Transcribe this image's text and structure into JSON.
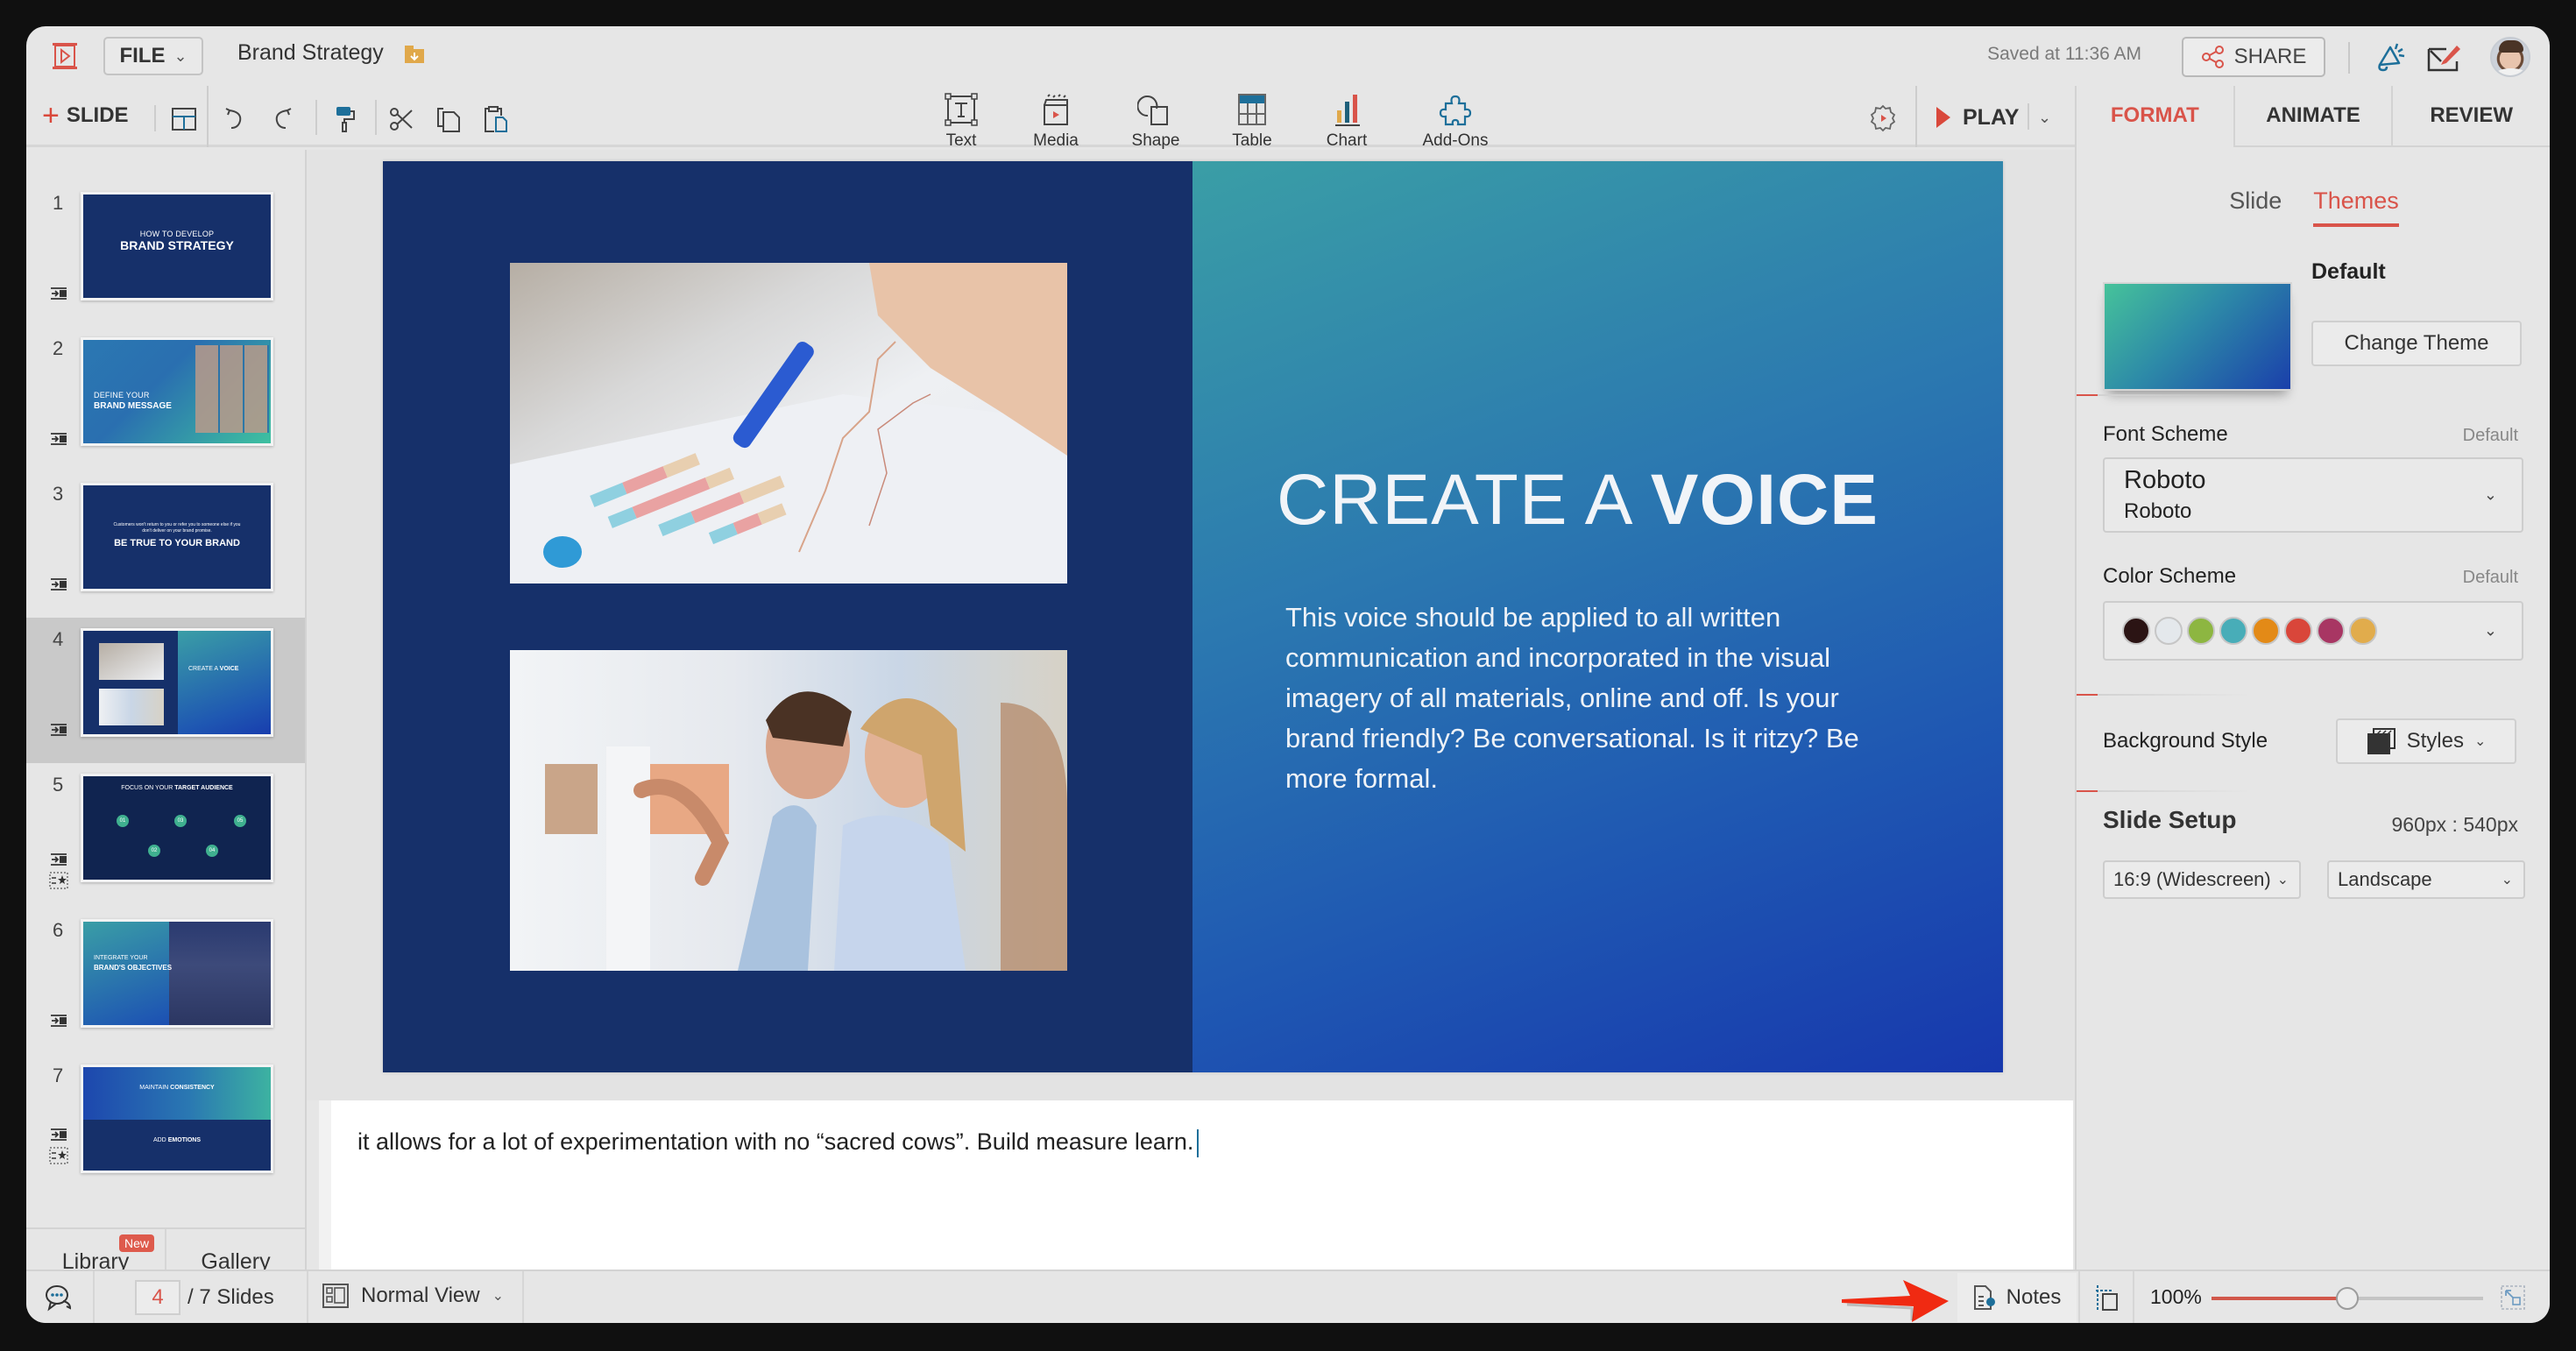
{
  "header": {
    "file_label": "FILE",
    "doc_title": "Brand Strategy",
    "saved_status": "Saved at 11:36 AM",
    "share_label": "SHARE"
  },
  "toolbar": {
    "add_slide_label": "SLIDE",
    "insert_items": [
      {
        "label": "Text",
        "icon": "text-box-icon"
      },
      {
        "label": "Media",
        "icon": "media-clapper-icon"
      },
      {
        "label": "Shape",
        "icon": "shape-icon"
      },
      {
        "label": "Table",
        "icon": "table-icon"
      },
      {
        "label": "Chart",
        "icon": "chart-icon"
      },
      {
        "label": "Add-Ons",
        "icon": "puzzle-icon"
      }
    ],
    "play_label": "PLAY"
  },
  "right_tabs": [
    {
      "label": "FORMAT",
      "active": true
    },
    {
      "label": "ANIMATE",
      "active": false
    },
    {
      "label": "REVIEW",
      "active": false
    }
  ],
  "format_panel": {
    "subtabs": [
      {
        "label": "Slide",
        "active": false
      },
      {
        "label": "Themes",
        "active": true
      }
    ],
    "theme_name": "Default",
    "change_theme_label": "Change Theme",
    "font_scheme": {
      "label": "Font Scheme",
      "hint": "Default",
      "heading_font": "Roboto",
      "body_font": "Roboto"
    },
    "color_scheme": {
      "label": "Color Scheme",
      "hint": "Default",
      "colors": [
        "#2b1414",
        "#e4e8ec",
        "#8db641",
        "#48adb8",
        "#e38a17",
        "#d9463a",
        "#a83663",
        "#e1ac4c"
      ]
    },
    "background_style": {
      "label": "Background Style",
      "button_label": "Styles"
    },
    "slide_setup": {
      "label": "Slide Setup",
      "dimensions": "960px : 540px",
      "ratio": "16:9 (Widescreen)",
      "orientation": "Landscape"
    }
  },
  "slides_panel": {
    "slides": [
      {
        "number": "1",
        "kicker": "HOW TO DEVELOP",
        "title": "BRAND STRATEGY",
        "has_animation": false
      },
      {
        "number": "2",
        "kicker": "DEFINE YOUR",
        "title": "BRAND MESSAGE",
        "has_animation": false
      },
      {
        "number": "3",
        "kicker": "Customers won't return to you or refer you to someone else if you don't deliver on your brand promise.",
        "title": "BE TRUE TO YOUR BRAND",
        "has_animation": false
      },
      {
        "number": "4",
        "kicker": "CREATE A",
        "title": "VOICE",
        "has_animation": false,
        "selected": true
      },
      {
        "number": "5",
        "kicker": "FOCUS ON YOUR",
        "title": "TARGET AUDIENCE",
        "has_animation": true,
        "points": [
          "01",
          "02",
          "03",
          "04",
          "05"
        ]
      },
      {
        "number": "6",
        "kicker": "INTEGRATE YOUR",
        "title": "BRAND'S OBJECTIVES",
        "has_animation": false
      },
      {
        "number": "7",
        "kicker": "MAINTAIN",
        "title": "CONSISTENCY",
        "kicker2": "ADD",
        "title2": "EMOTIONS",
        "has_animation": true
      }
    ],
    "library_label": "Library",
    "library_badge": "New",
    "gallery_label": "Gallery"
  },
  "slide": {
    "title_light": "CREATE A",
    "title_bold": "VOICE",
    "body": "This voice should be applied to all written communication and incorporated in the visual imagery of all materials, online and off. Is your brand friendly? Be conversational. Is it ritzy? Be more formal.",
    "images": [
      "hand-with-pen-over-charts-photo",
      "two-people-at-computer-photo"
    ]
  },
  "notes": {
    "text": "it allows for a lot of experimentation with no “sacred cows”. Build measure learn."
  },
  "status_bar": {
    "current_slide": "4",
    "total_slides": "/ 7 Slides",
    "view_label": "Normal View",
    "notes_label": "Notes",
    "zoom_label": "100%",
    "zoom_fraction": 0.5
  },
  "colors": {
    "accent": "#d9544a",
    "slide_navy": "#16306a",
    "icon_teal": "#1d6f9a"
  }
}
